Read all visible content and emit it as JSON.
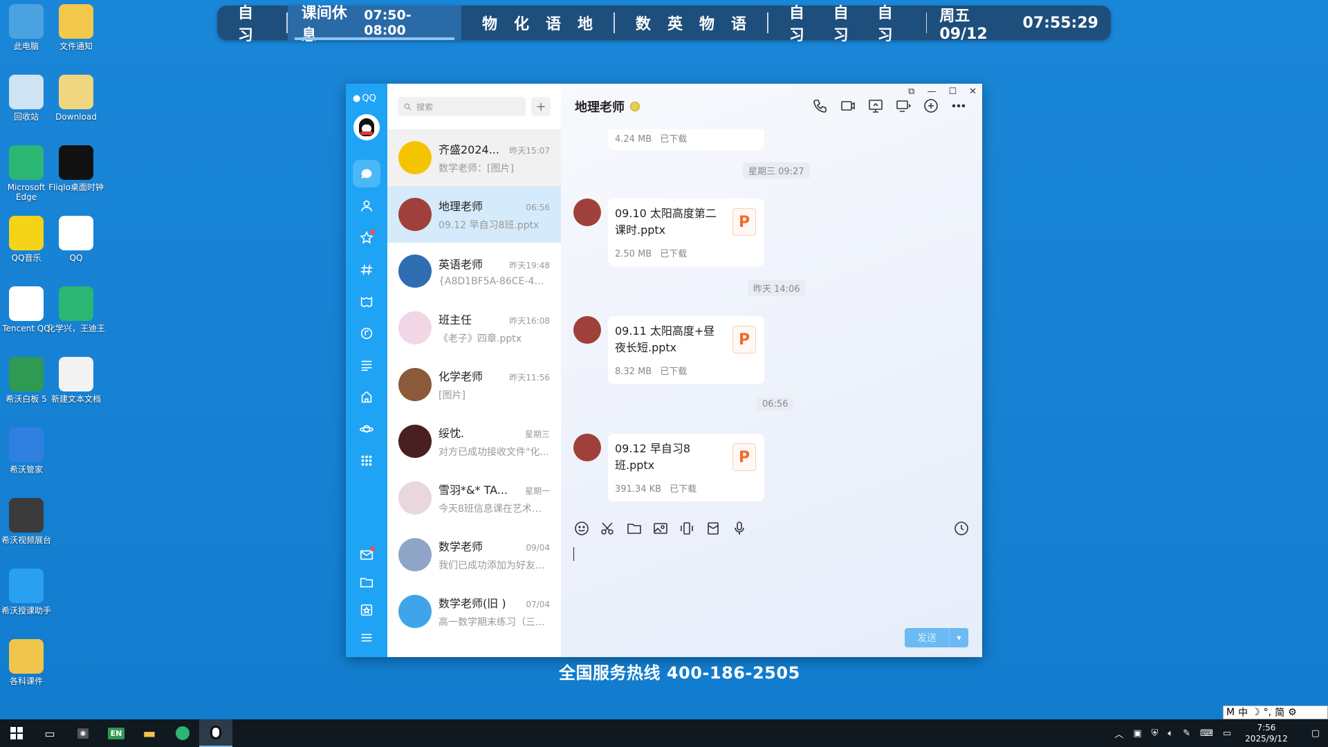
{
  "desktop_icons": [
    {
      "label": "此电脑",
      "icon": "computer-icon",
      "color": "#4aa3e0"
    },
    {
      "label": "文件通知",
      "icon": "folder-warning-icon",
      "color": "#f3c84b"
    },
    {
      "label": "回收站",
      "icon": "recycle-bin-icon",
      "color": "#cfe3f2"
    },
    {
      "label": "Download",
      "icon": "folder-doc-icon",
      "color": "#f0d680"
    },
    {
      "label": "Microsoft Edge",
      "icon": "edge-icon",
      "color": "#2bb673"
    },
    {
      "label": "Fliqlo桌面时钟",
      "icon": "clock-icon",
      "color": "#111111"
    },
    {
      "label": "QQ音乐",
      "icon": "qq-music-icon",
      "color": "#f5d316"
    },
    {
      "label": "QQ",
      "icon": "qq-penguin-icon",
      "color": "#ffffff"
    },
    {
      "label": "Tencent QQ",
      "icon": "qq-penguin-icon",
      "color": "#ffffff"
    },
    {
      "label": "化学兴，王迪王",
      "icon": "edge-icon",
      "color": "#2bb673"
    },
    {
      "label": "希沃白板 5",
      "icon": "en-board-icon",
      "color": "#2e9a52"
    },
    {
      "label": "新建文本文档",
      "icon": "text-doc-icon",
      "color": "#f2f2f2"
    },
    {
      "label": "希沃管家",
      "icon": "shield-icon",
      "color": "#2f7fe0"
    },
    {
      "label": "希沃视频展台",
      "icon": "camera-icon",
      "color": "#3b3b3b"
    },
    {
      "label": "希沃授课助手",
      "icon": "link-icon",
      "color": "#2aa1f0"
    },
    {
      "label": "各科课件",
      "icon": "folder-icon",
      "color": "#f0c54b"
    }
  ],
  "schedule": {
    "left": [
      "自习"
    ],
    "active_label": "课间休息",
    "active_time": "07:50-08:00",
    "group1": [
      "物",
      "化",
      "语",
      "地"
    ],
    "group2": [
      "数",
      "英",
      "物",
      "语"
    ],
    "group3": [
      "自习",
      "自习",
      "自习"
    ],
    "day_date": "周五 09/12",
    "clock": "07:55:29"
  },
  "qq": {
    "logo_text": "QQ",
    "search_placeholder": "搜索",
    "conversations": [
      {
        "name": "齐盛2024...",
        "time": "昨天15:07",
        "msg": "数学老师：[图片]",
        "avatar": "#f5c400"
      },
      {
        "name": "地理老师",
        "time": "06:56",
        "msg": "09.12 早自习8班.pptx",
        "avatar": "#a0403a"
      },
      {
        "name": "英语老师",
        "time": "昨天19:48",
        "msg": "{A8D1BF5A-86CE-468...",
        "avatar": "#2f6db3"
      },
      {
        "name": "班主任",
        "time": "昨天16:08",
        "msg": "《老子》四章.pptx",
        "avatar": "#f1d7e6"
      },
      {
        "name": "化学老师",
        "time": "昨天11:56",
        "msg": "[图片]",
        "avatar": "#8a5a3a"
      },
      {
        "name": "绥忱.",
        "time": "星期三",
        "msg": "对方已成功接收文件\"化...",
        "avatar": "#4a1f1f"
      },
      {
        "name": "雪羽*&* TA...",
        "time": "星期一",
        "msg": "今天8班信息课在艺术楼...",
        "avatar": "#e9d7dd"
      },
      {
        "name": "数学老师",
        "time": "09/04",
        "msg": "我们已成功添加为好友...",
        "avatar": "#8ea5c8"
      },
      {
        "name": "数学老师(旧 )",
        "time": "07/04",
        "msg": "高一数学期末练习（三...",
        "avatar": "#3fa5e8"
      }
    ],
    "chat_title": "地理老师",
    "partial_file": {
      "size": "4.24 MB",
      "status": "已下载"
    },
    "messages": [
      {
        "stamp": "星期三 09:27",
        "file": "09.10 太阳高度第二课时.pptx",
        "size": "2.50 MB",
        "status": "已下载"
      },
      {
        "stamp": "昨天 14:06",
        "file": "09.11 太阳高度+昼夜长短.pptx",
        "size": "8.32 MB",
        "status": "已下载"
      },
      {
        "stamp": "06:56",
        "file": "09.12 早自习8班.pptx",
        "size": "391.34 KB",
        "status": "已下载"
      }
    ],
    "ppt_letter": "P",
    "send_label": "发送"
  },
  "hotline": "全国服务热线 400-186-2505",
  "ime": {
    "mode": "中",
    "variant": "简"
  },
  "taskbar": {
    "time": "7:56",
    "date": "2025/9/12"
  }
}
